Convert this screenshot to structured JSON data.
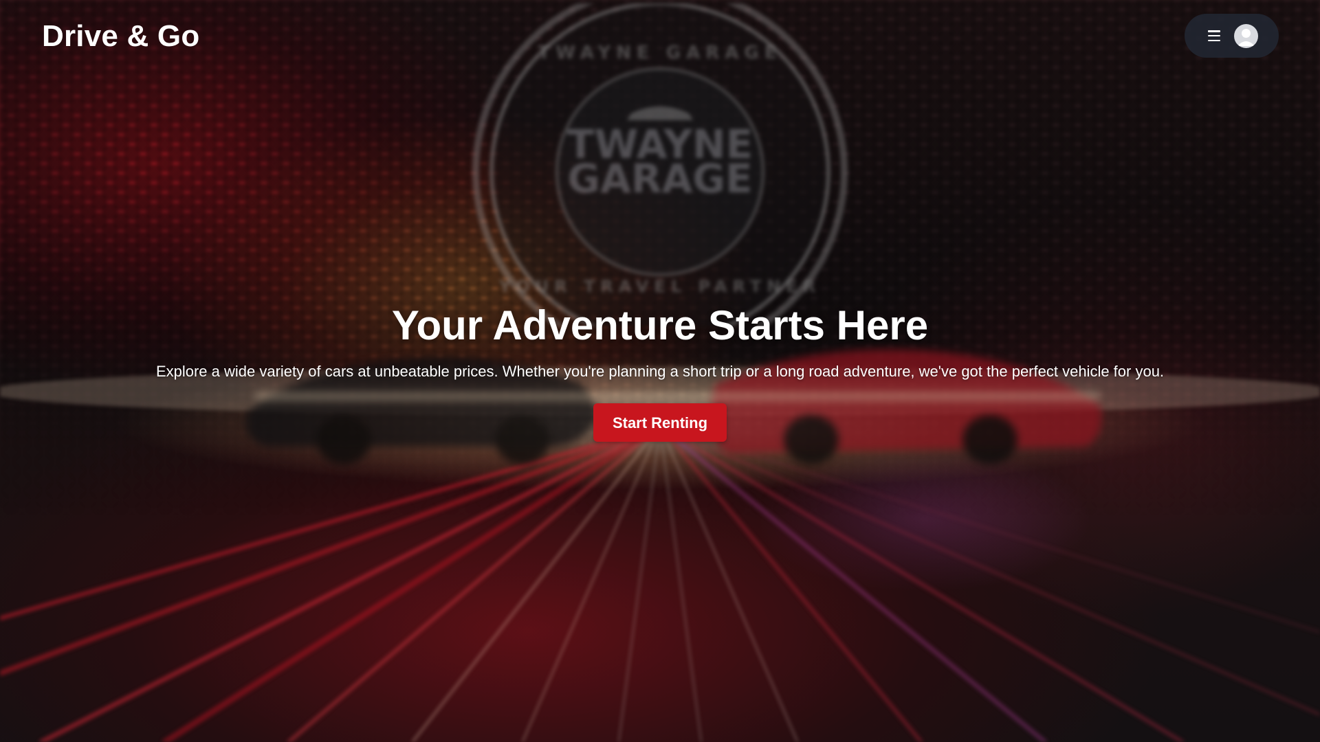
{
  "header": {
    "brand": "Drive & Go",
    "menu_icon": "hamburger-menu-icon",
    "avatar_icon": "user-avatar-icon"
  },
  "background": {
    "emblem": {
      "arc_top": "TWAYNE GARAGE",
      "name_line1": "TWAYNE",
      "name_line2": "GARAGE",
      "arc_bottom": "YOUR TRAVEL PARTNER"
    }
  },
  "hero": {
    "title": "Your Adventure Starts Here",
    "subtitle": "Explore a wide variety of cars at unbeatable prices. Whether you're planning a short trip or a long road adventure, we've got the perfect vehicle for you.",
    "cta_label": "Start Renting"
  },
  "colors": {
    "accent": "#c8161e",
    "pill_bg": "#222834",
    "text": "#ffffff"
  }
}
